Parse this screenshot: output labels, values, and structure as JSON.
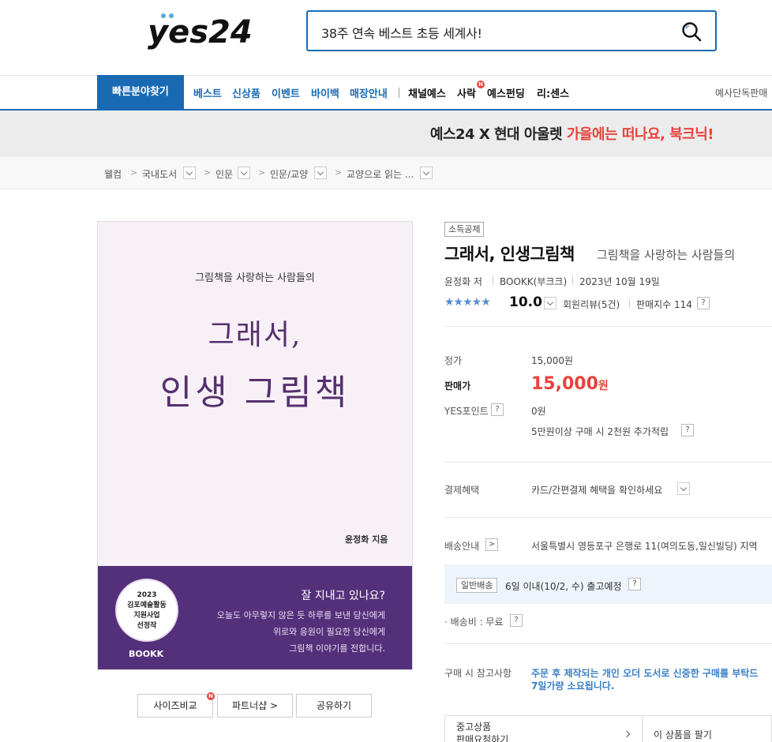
{
  "header": {
    "logo_text": "yes24",
    "search_value": "38주 연속 베스트 초등 세계사!"
  },
  "gnb": {
    "category_button": "빠른분야찾기",
    "items": [
      "베스트",
      "신상품",
      "이벤트",
      "바이백",
      "매장안내"
    ],
    "items_dark": [
      "채널예스",
      "사락",
      "예스펀딩",
      "리:센스"
    ],
    "new_badge": "N",
    "right_text": "예사단독판매"
  },
  "banner": {
    "text_plain": "예스24 X 현대 아울렛 ",
    "text_highlight": "가을에는 떠나요, 북크닉!"
  },
  "breadcrumb": [
    "웰컴",
    "국내도서",
    "인문",
    "인문/교양",
    "교양으로 읽는 ..."
  ],
  "cover": {
    "subtitle": "그림책을 사랑하는 사람들의",
    "title_line1": "그래서,",
    "title_line2": "인생 그림책",
    "author": "윤정화 지음",
    "seal_lines": [
      "2023",
      "김포예술활동",
      "지원사업",
      "선정작"
    ],
    "brand": "BOOKK",
    "question": "잘 지내고 있나요?",
    "message": [
      "오늘도 아무렇지 않은 듯 하루를 보낸 당신에게",
      "위로와 응원이 필요한 당신에게",
      "그림책 이야기를 전합니다."
    ]
  },
  "cover_buttons": [
    "사이즈비교",
    "파트너샵 >",
    "공유하기"
  ],
  "product": {
    "tag": "소득공제",
    "title": "그래서, 인생그림책",
    "subtitle": "그림책을 사랑하는 사람들의",
    "author": "윤정화 저",
    "publisher": "BOOKK(부크크)",
    "date": "2023년 10월 19일",
    "stars": "★★★★★",
    "rating": "10.0",
    "review": "회원리뷰(5건)",
    "sales": "판매지수 114",
    "help": "?"
  },
  "pricing": {
    "list_label": "정가",
    "list_price": "15,000원",
    "sale_label": "판매가",
    "sale_price": "15,000",
    "sale_unit": "원",
    "points_label": "YES포인트",
    "points_value": "0원",
    "points_note": "5만원이상 구매 시 2천원 추가적립"
  },
  "benefit": {
    "label": "결제혜택",
    "value": "카드/간편결제 혜택을 확인하세요"
  },
  "shipping": {
    "label": "배송안내",
    "address": "서울특별시 영등포구 은행로 11(여의도동,일신빌딩) 지역",
    "type": "일반배송",
    "eta": "6일 이내(10/2, 수) 출고예정",
    "fee": "· 배송비 : 무료"
  },
  "purchase_note": {
    "label": "구매 시 참고사항",
    "line1": "주문 후 제작되는 개인 오더 도서로 신중한 구매를 부탁드",
    "line2": "7일가량 소요됩니다."
  },
  "used": {
    "left_line1": "중고상품",
    "left_line2": "판매요청하기",
    "right": "이 상품을 팔기"
  }
}
